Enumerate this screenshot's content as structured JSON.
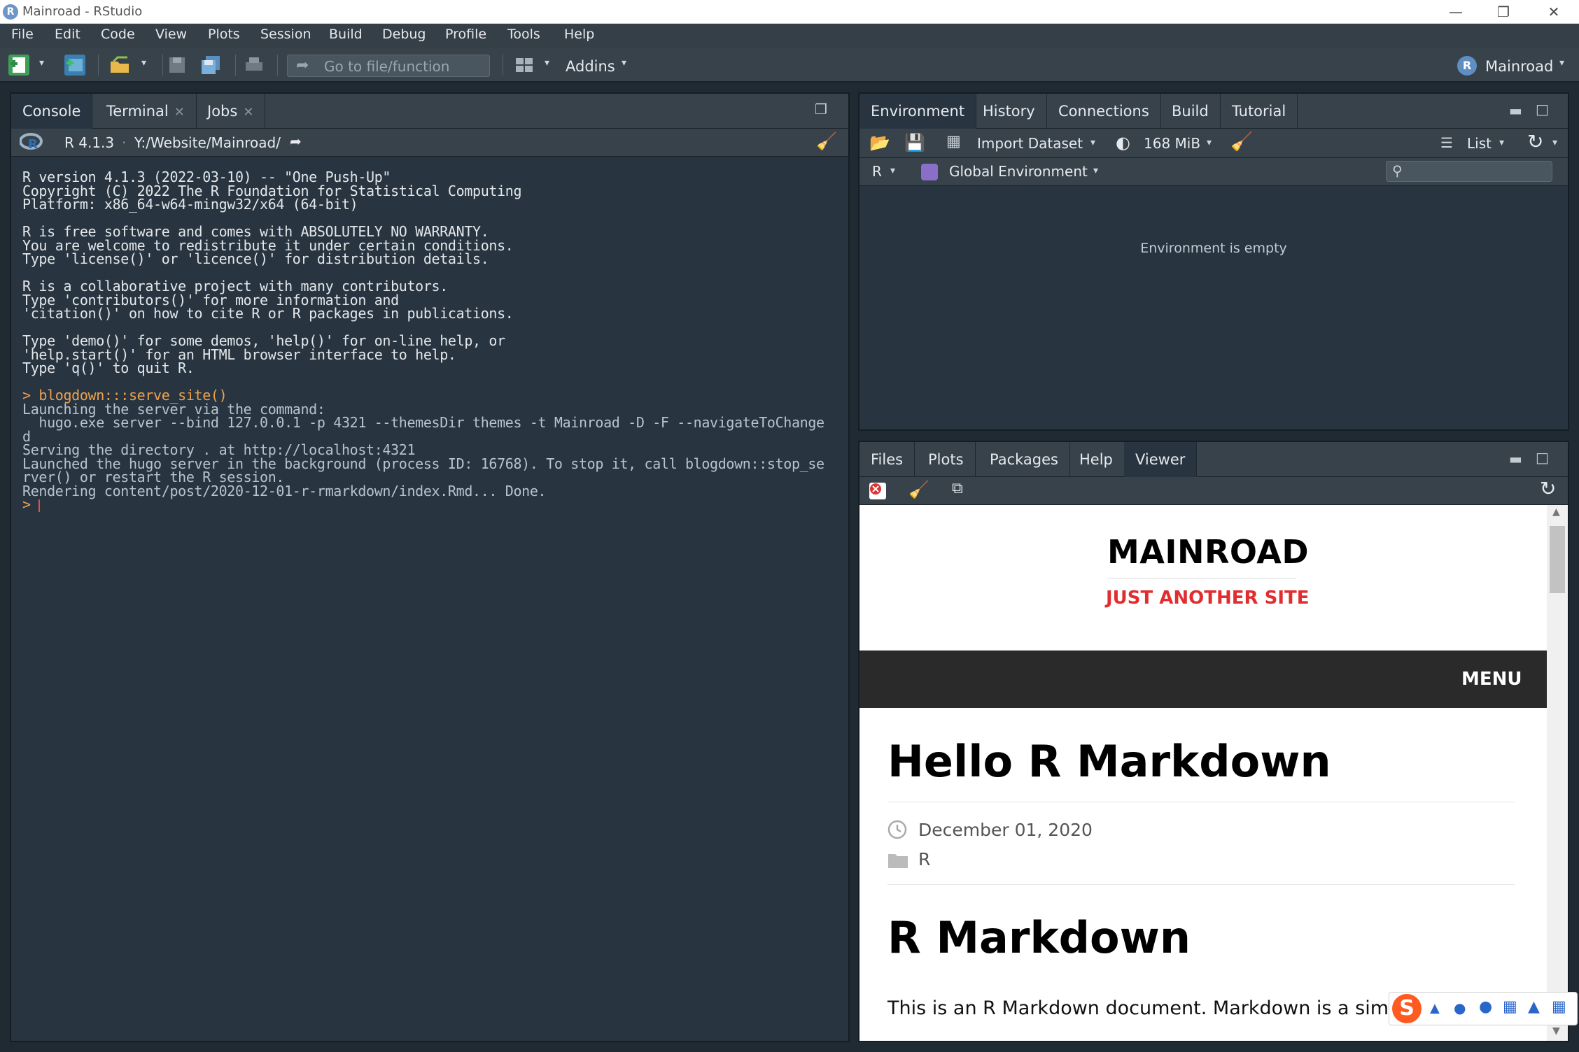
{
  "window": {
    "title": "Mainroad - RStudio",
    "controls": [
      "minimize",
      "restore",
      "close"
    ]
  },
  "menu": [
    "File",
    "Edit",
    "Code",
    "View",
    "Plots",
    "Session",
    "Build",
    "Debug",
    "Profile",
    "Tools",
    "Help"
  ],
  "toolbar": {
    "goto_placeholder": "Go to file/function",
    "addins_label": "Addins",
    "project_label": "Mainroad"
  },
  "console_panel": {
    "tabs": [
      {
        "label": "Console",
        "closable": false
      },
      {
        "label": "Terminal",
        "closable": true
      },
      {
        "label": "Jobs",
        "closable": true
      }
    ],
    "r_version_label": "R 4.1.3",
    "working_dir": "Y:/Website/Mainroad/",
    "lines": [
      {
        "t": "R version 4.1.3 (2022-03-10) -- \"One Push-Up\"",
        "k": "std"
      },
      {
        "t": "Copyright (C) 2022 The R Foundation for Statistical Computing",
        "k": "std"
      },
      {
        "t": "Platform: x86_64-w64-mingw32/x64 (64-bit)",
        "k": "std"
      },
      {
        "t": "",
        "k": "std"
      },
      {
        "t": "R is free software and comes with ABSOLUTELY NO WARRANTY.",
        "k": "std"
      },
      {
        "t": "You are welcome to redistribute it under certain conditions.",
        "k": "std"
      },
      {
        "t": "Type 'license()' or 'licence()' for distribution details.",
        "k": "std"
      },
      {
        "t": "",
        "k": "std"
      },
      {
        "t": "R is a collaborative project with many contributors.",
        "k": "std"
      },
      {
        "t": "Type 'contributors()' for more information and",
        "k": "std"
      },
      {
        "t": "'citation()' on how to cite R or R packages in publications.",
        "k": "std"
      },
      {
        "t": "",
        "k": "std"
      },
      {
        "t": "Type 'demo()' for some demos, 'help()' for on-line help, or",
        "k": "std"
      },
      {
        "t": "'help.start()' for an HTML browser interface to help.",
        "k": "std"
      },
      {
        "t": "Type 'q()' to quit R.",
        "k": "std"
      },
      {
        "t": "",
        "k": "std"
      },
      {
        "t": "> blogdown:::serve_site()",
        "k": "cmd"
      },
      {
        "t": "Launching the server via the command:",
        "k": "out"
      },
      {
        "t": "  hugo.exe server --bind 127.0.0.1 -p 4321 --themesDir themes -t Mainroad -D -F --navigateToChange",
        "k": "out"
      },
      {
        "t": "d",
        "k": "out"
      },
      {
        "t": "Serving the directory . at http://localhost:4321",
        "k": "out"
      },
      {
        "t": "Launched the hugo server in the background (process ID: 16768). To stop it, call blogdown::stop_se",
        "k": "out"
      },
      {
        "t": "rver() or restart the R session.",
        "k": "out"
      },
      {
        "t": "Rendering content/post/2020-12-01-r-rmarkdown/index.Rmd... Done.",
        "k": "out"
      },
      {
        "t": "> ",
        "k": "cmd"
      }
    ]
  },
  "env_panel": {
    "tabs": [
      "Environment",
      "History",
      "Connections",
      "Build",
      "Tutorial"
    ],
    "import_label": "Import Dataset",
    "memory_label": "168 MiB",
    "list_label": "List",
    "lang_label": "R",
    "scope_label": "Global Environment",
    "empty_message": "Environment is empty"
  },
  "files_panel": {
    "tabs": [
      "Files",
      "Plots",
      "Packages",
      "Help",
      "Viewer"
    ],
    "active_tab": "Viewer"
  },
  "viewer": {
    "site_title": "MAINROAD",
    "site_tagline": "JUST ANOTHER SITE",
    "menu_label": "MENU",
    "post_title": "Hello R Markdown",
    "post_date": "December 01, 2020",
    "post_category": "R",
    "section_heading": "R Markdown",
    "body_text": "This is an R Markdown document. Markdown is a simple"
  },
  "colors": {
    "tagline_red": "#e22d30",
    "menu_bar": "#2a2a2a",
    "console_bg": "#283541",
    "command_orange": "#f0a14b"
  }
}
